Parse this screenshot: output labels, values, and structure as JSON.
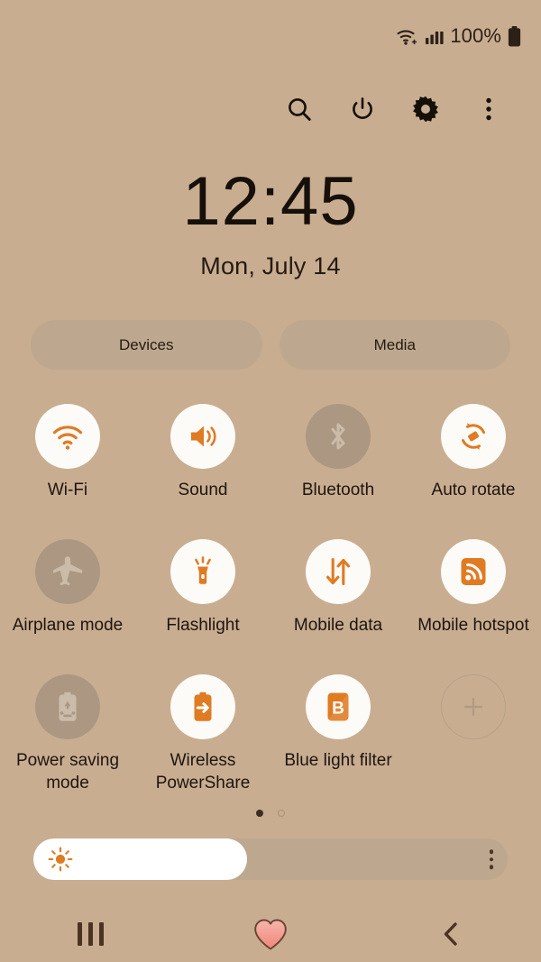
{
  "status_bar": {
    "wifi_icon": "wifi-plus-icon",
    "signal_icon": "signal-bars-icon",
    "battery_icon": "battery-full-icon",
    "battery_text": "100%"
  },
  "header": {
    "buttons": [
      {
        "name": "search-icon",
        "label": "Search"
      },
      {
        "name": "power-icon",
        "label": "Power off"
      },
      {
        "name": "settings-icon",
        "label": "Settings"
      },
      {
        "name": "overflow-icon",
        "label": "More options"
      }
    ]
  },
  "clock": {
    "time": "12:45",
    "date": "Mon, July 14"
  },
  "pills": {
    "devices": "Devices",
    "media": "Media"
  },
  "tiles": [
    {
      "label": "Wi-Fi",
      "icon": "wifi-icon",
      "state": "on"
    },
    {
      "label": "Sound",
      "icon": "sound-icon",
      "state": "on"
    },
    {
      "label": "Bluetooth",
      "icon": "bluetooth-icon",
      "state": "off"
    },
    {
      "label": "Auto rotate",
      "icon": "auto-rotate-icon",
      "state": "on"
    },
    {
      "label": "Airplane mode",
      "icon": "airplane-icon",
      "state": "off"
    },
    {
      "label": "Flashlight",
      "icon": "flashlight-icon",
      "state": "on"
    },
    {
      "label": "Mobile data",
      "icon": "mobile-data-icon",
      "state": "on"
    },
    {
      "label": "Mobile hotspot",
      "icon": "hotspot-icon",
      "state": "on"
    },
    {
      "label": "Power saving mode",
      "icon": "power-saving-icon",
      "state": "off"
    },
    {
      "label": "Wireless PowerShare",
      "icon": "powershare-icon",
      "state": "on"
    },
    {
      "label": "Blue light filter",
      "icon": "blue-light-icon",
      "state": "on"
    },
    {
      "label": "",
      "icon": "add-tile-icon",
      "state": "add"
    }
  ],
  "pager": {
    "total": 2,
    "active_index": 0
  },
  "brightness": {
    "icon": "brightness-sun-icon",
    "percent": 45,
    "menu_icon": "brightness-options-icon"
  },
  "navbar": {
    "recents": "Recents",
    "home": "Home",
    "back": "Back",
    "home_icon": "heart-home-icon"
  },
  "colors": {
    "background": "#c9ad90",
    "accent": "#e07b23",
    "tile_on_bg": "#fdfbf8",
    "tile_off_bg": "#ab9782",
    "pill_bg": "#bda88f",
    "text": "#1d1510"
  }
}
